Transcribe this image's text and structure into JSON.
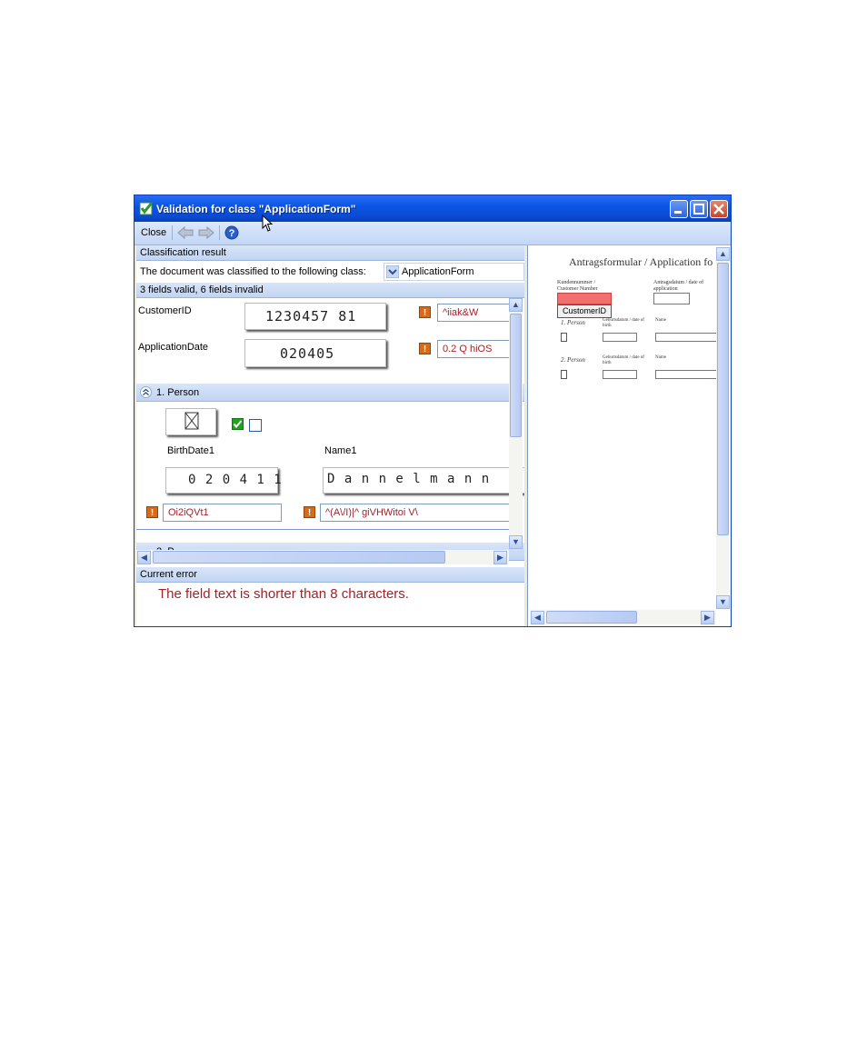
{
  "window": {
    "title": "Validation for class \"ApplicationForm\""
  },
  "toolbar": {
    "close_label": "Close"
  },
  "classification": {
    "header": "Classification result",
    "text": "The document was classified to the following class:",
    "selected_class": "ApplicationForm"
  },
  "fields_status": "3 fields valid, 6 fields invalid",
  "fields": {
    "customer_id": {
      "label": "CustomerID",
      "handwriting": "1230457 81",
      "value": "^iiak&W"
    },
    "application_date": {
      "label": "ApplicationDate",
      "handwriting": "020405",
      "value": "0.2 Q hiOS"
    }
  },
  "person1": {
    "section_label": "1. Person",
    "birthdate_label": "BirthDate1",
    "birthdate_handwriting": "0 2 0 4 1 1",
    "birthdate_value": "Oi2iQVt1",
    "name_label": "Name1",
    "name_handwriting": "D a n n e l m a n n",
    "name_value": "^(A\\/I)|^ giVHWitoi V\\"
  },
  "person2": {
    "section_label": "2. P"
  },
  "current_error": {
    "header": "Current error",
    "message": "The field text is shorter than 8 characters."
  },
  "document_preview": {
    "title": "Antragsformular / Application fo",
    "customer_number_label": "Kundennummer / Customer Number",
    "application_date_label": "Antragsdatum / date of application",
    "tooltip": "CustomerID",
    "person1": "1. Person",
    "person2": "2. Person",
    "birth_label": "Geburtsdatum / date of birth",
    "name_label": "Name"
  },
  "colors": {
    "titlebar": "#0b55e6",
    "error_text": "#a0232a",
    "highlight": "#f07070"
  }
}
